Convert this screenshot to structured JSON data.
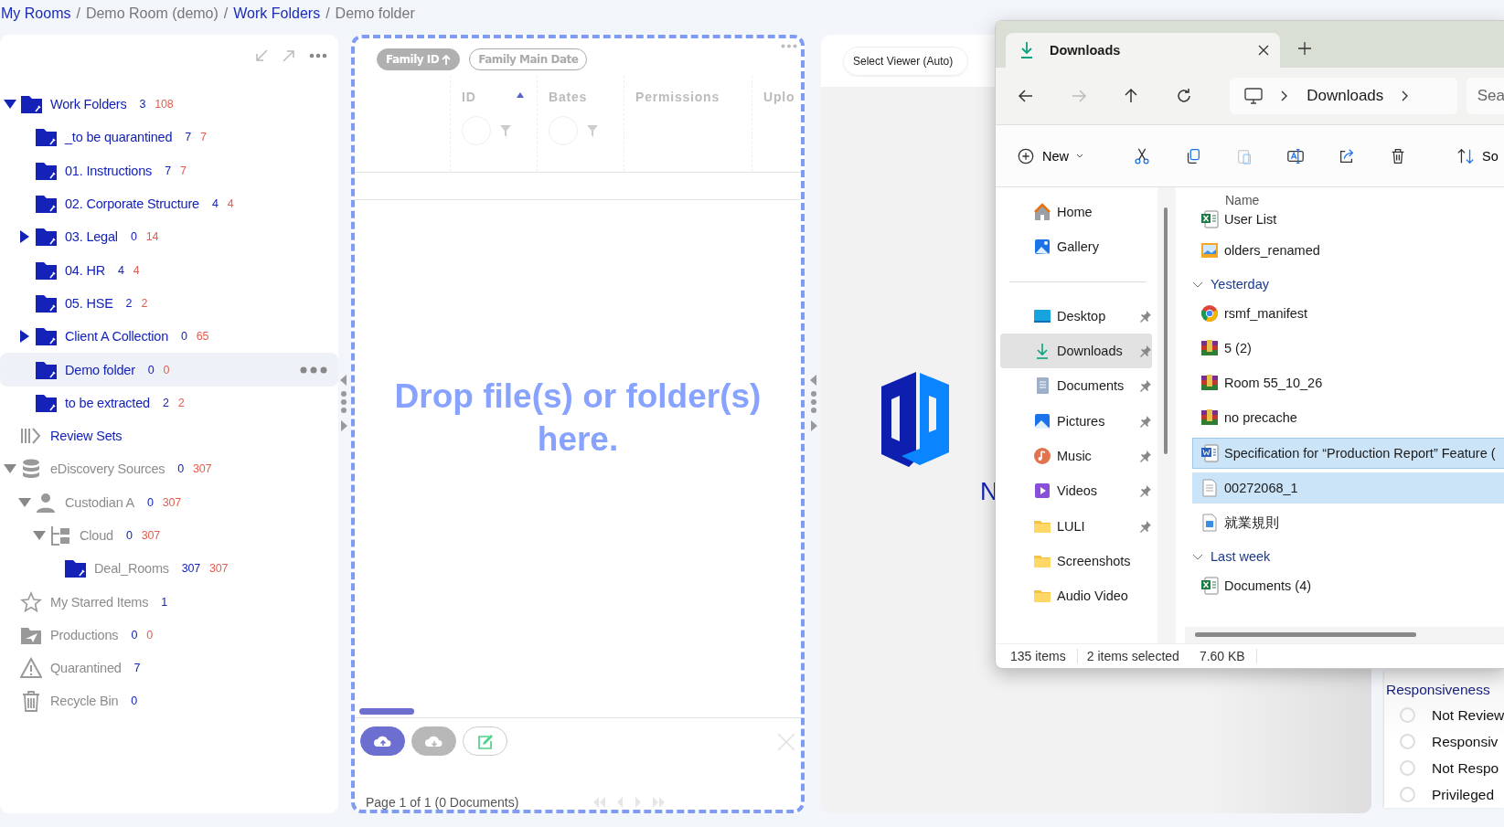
{
  "breadcrumb": {
    "separator": "/",
    "items": [
      {
        "label": "My Rooms",
        "link": true
      },
      {
        "label": "Demo Room (demo)",
        "link": false
      },
      {
        "label": "Work Folders",
        "link": true
      },
      {
        "label": "Demo folder",
        "link": false
      }
    ]
  },
  "tree": [
    {
      "kind": "folder",
      "label": "Work Folders",
      "count": "3",
      "total": "108",
      "expanded": true,
      "selected": false,
      "children": [
        {
          "kind": "folder",
          "label": "_to be quarantined",
          "count": "7",
          "total": "7",
          "selected": false
        },
        {
          "kind": "folder",
          "label": "01. Instructions",
          "count": "7",
          "total": "7",
          "selected": false
        },
        {
          "kind": "folder",
          "label": "02. Corporate Structure",
          "count": "4",
          "total": "4",
          "selected": false
        },
        {
          "kind": "folder",
          "label": "03. Legal",
          "count": "0",
          "total": "14",
          "expanded": false,
          "selected": false
        },
        {
          "kind": "folder",
          "label": "04. HR",
          "count": "4",
          "total": "4",
          "selected": false
        },
        {
          "kind": "folder",
          "label": "05. HSE",
          "count": "2",
          "total": "2",
          "selected": false
        },
        {
          "kind": "folder",
          "label": "Client A Collection",
          "count": "0",
          "total": "65",
          "expanded": false,
          "selected": false
        },
        {
          "kind": "folder",
          "label": "Demo folder",
          "count": "0",
          "total": "0",
          "selected": true
        },
        {
          "kind": "folder",
          "label": "to be extracted",
          "count": "2",
          "total": "2",
          "selected": false
        }
      ]
    },
    {
      "kind": "review",
      "label": "Review Sets",
      "selected": false
    },
    {
      "kind": "database",
      "label": "eDiscovery Sources",
      "count": "0",
      "total": "307",
      "expanded": true,
      "selected": false,
      "children": [
        {
          "kind": "person",
          "label": "Custodian A",
          "count": "0",
          "total": "307",
          "expanded": true,
          "selected": false,
          "children": [
            {
              "kind": "cloud",
              "label": "Cloud",
              "count": "0",
              "total": "307",
              "expanded": true,
              "selected": false,
              "children": [
                {
                  "kind": "source-folder",
                  "label": "Deal_Rooms",
                  "count": "307",
                  "total": "307",
                  "selected": false
                }
              ]
            }
          ]
        }
      ]
    },
    {
      "kind": "star",
      "label": "My Starred Items",
      "count": "1",
      "selected": false
    },
    {
      "kind": "production",
      "label": "Productions",
      "count": "0",
      "total": "0",
      "selected": false
    },
    {
      "kind": "warning",
      "label": "Quarantined",
      "count": "7",
      "selected": false
    },
    {
      "kind": "trash",
      "label": "Recycle Bin",
      "count": "0",
      "selected": false
    }
  ],
  "documents": {
    "sort_chips": [
      {
        "label": "Family ID",
        "selected": true
      },
      {
        "label": "Family Main Date",
        "selected": false
      }
    ],
    "columns": [
      {
        "label": "ID",
        "sorted": true,
        "filter": true
      },
      {
        "label": "Bates",
        "sorted": false,
        "filter": true
      },
      {
        "label": "Permissions",
        "sorted": false,
        "filter": false
      },
      {
        "label": "Uplo",
        "sorted": false,
        "filter": false
      }
    ],
    "drop_message": "Drop file(s) or folder(s) here.",
    "actions": [
      {
        "kind": "upload"
      },
      {
        "kind": "download"
      },
      {
        "kind": "edit"
      }
    ],
    "page_info": "Page 1 of 1 (0 Documents)"
  },
  "viewer": {
    "select": {
      "value": "Select Viewer (Auto)"
    },
    "logo_text": "N"
  },
  "explorer": {
    "tab": {
      "title": "Downloads"
    },
    "nav_buttons": [
      {
        "kind": "back",
        "disabled": false
      },
      {
        "kind": "forward",
        "disabled": true
      },
      {
        "kind": "up",
        "disabled": false
      },
      {
        "kind": "refresh",
        "disabled": false
      }
    ],
    "address": [
      "Downloads"
    ],
    "search": {
      "placeholder": "Sea"
    },
    "toolbar": [
      {
        "kind": "new",
        "label": "New",
        "disabled": false
      },
      {
        "kind": "cut",
        "disabled": false
      },
      {
        "kind": "copy",
        "disabled": false
      },
      {
        "kind": "paste",
        "disabled": true
      },
      {
        "kind": "rename",
        "disabled": false
      },
      {
        "kind": "share",
        "disabled": false
      },
      {
        "kind": "delete",
        "disabled": false
      },
      {
        "kind": "sort",
        "label": "So",
        "disabled": false
      }
    ],
    "quick": [
      {
        "kind": "home",
        "label": "Home",
        "pinned": false,
        "selected": false
      },
      {
        "kind": "gallery",
        "label": "Gallery",
        "pinned": false,
        "selected": false
      }
    ],
    "places": [
      {
        "kind": "desktop",
        "label": "Desktop",
        "pinned": true,
        "selected": false
      },
      {
        "kind": "downloads",
        "label": "Downloads",
        "pinned": true,
        "selected": true
      },
      {
        "kind": "documents",
        "label": "Documents",
        "pinned": true,
        "selected": false
      },
      {
        "kind": "pictures",
        "label": "Pictures",
        "pinned": true,
        "selected": false
      },
      {
        "kind": "music",
        "label": "Music",
        "pinned": true,
        "selected": false
      },
      {
        "kind": "videos",
        "label": "Videos",
        "pinned": true,
        "selected": false
      },
      {
        "kind": "folder",
        "label": "LULI",
        "pinned": true,
        "selected": false
      },
      {
        "kind": "folder",
        "label": "Screenshots",
        "pinned": false,
        "selected": false
      },
      {
        "kind": "folder",
        "label": "Audio Video",
        "pinned": false,
        "selected": false
      }
    ],
    "column": "Name",
    "rows": [
      {
        "kind": "excel",
        "label": "User List",
        "selected": false,
        "focused": false
      },
      {
        "kind": "image",
        "label": "olders_renamed",
        "selected": false,
        "focused": false
      },
      {
        "kind": "group",
        "label": "Yesterday",
        "expanded": true
      },
      {
        "kind": "chrome",
        "label": "rsmf_manifest",
        "selected": false,
        "focused": false
      },
      {
        "kind": "archive",
        "label": "5 (2)",
        "selected": false,
        "focused": false
      },
      {
        "kind": "archive",
        "label": "Room 55_10_26",
        "selected": false,
        "focused": false
      },
      {
        "kind": "archive",
        "label": "no precache",
        "selected": false,
        "focused": false
      },
      {
        "kind": "word",
        "label": "Specification for “Production Report” Feature (",
        "selected": true,
        "focused": true
      },
      {
        "kind": "text",
        "label": "00272068_1",
        "selected": true,
        "focused": false
      },
      {
        "kind": "picture-doc",
        "label": "就業規則",
        "selected": false,
        "focused": false
      },
      {
        "kind": "group",
        "label": "Last week",
        "expanded": true
      },
      {
        "kind": "excel",
        "label": "Documents (4)",
        "selected": false,
        "focused": false
      }
    ],
    "status": [
      "135 items",
      "2 items selected",
      "7.60 KB"
    ]
  },
  "responsiveness": {
    "title": "Responsiveness",
    "options": [
      {
        "label": "Not Review",
        "checked": false
      },
      {
        "label": "Responsiv",
        "checked": false
      },
      {
        "label": "Not Respo",
        "checked": false
      },
      {
        "label": "Privileged",
        "checked": false
      }
    ]
  }
}
